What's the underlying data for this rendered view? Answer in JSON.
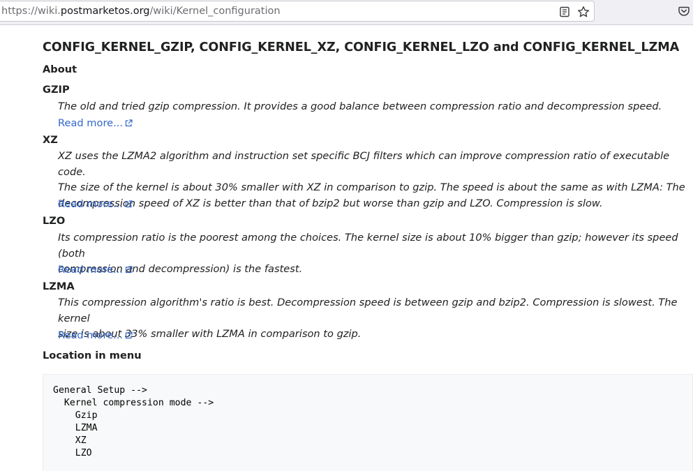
{
  "browser": {
    "url_prefix": "https://wiki.",
    "url_domain": "postmarketos.org",
    "url_path": "/wiki/Kernel_configuration",
    "icons": [
      "reader-view-icon",
      "bookmark-star-icon",
      "pocket-icon"
    ]
  },
  "page": {
    "title": "CONFIG_KERNEL_GZIP, CONFIG_KERNEL_XZ, CONFIG_KERNEL_LZO and CONFIG_KERNEL_LZMA",
    "about_heading": "About",
    "sections": [
      {
        "name": "GZIP",
        "lines": [
          "The old and tried gzip compression. It provides a good balance between compression ratio and decompression speed."
        ],
        "read_more": "Read more..."
      },
      {
        "name": "XZ",
        "lines": [
          "XZ uses the LZMA2 algorithm and instruction set specific BCJ filters which can improve compression ratio of executable code.",
          "The size of the kernel is about 30% smaller with XZ in comparison to gzip. The speed is about the same as with LZMA: The",
          "decompression speed of XZ is better than that of bzip2 but worse than gzip and LZO. Compression is slow."
        ],
        "read_more": "Read more..."
      },
      {
        "name": "LZO",
        "lines": [
          "Its compression ratio is the poorest among the choices. The kernel size is about 10% bigger than gzip; however its speed (both",
          "compression and decompression) is the fastest."
        ],
        "read_more": "Read more..."
      },
      {
        "name": "LZMA",
        "lines": [
          "This compression algorithm's ratio is best. Decompression speed is between gzip and bzip2. Compression is slowest. The kernel",
          "size is about 33% smaller with LZMA in comparison to gzip."
        ],
        "read_more": "Read more..."
      }
    ],
    "location_heading": "Location in menu",
    "menu_lines": [
      "General Setup -->",
      "  Kernel compression mode -->",
      "    Gzip",
      "    LZMA",
      "    XZ",
      "    LZO"
    ]
  },
  "colors": {
    "link": "#3366cc",
    "text": "#202122",
    "code_bg": "#f8f9fa"
  }
}
